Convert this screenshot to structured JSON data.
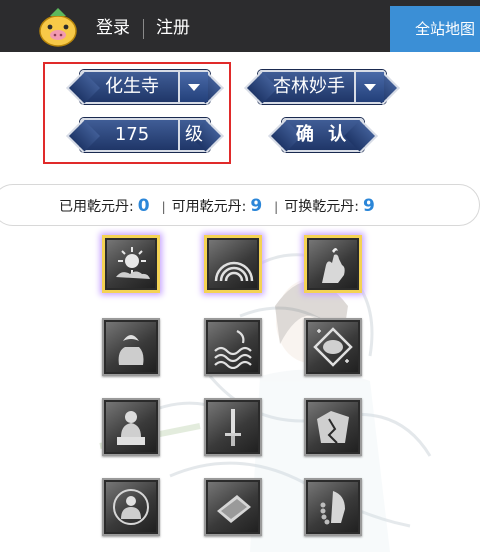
{
  "header": {
    "login_label": "登录",
    "register_label": "注册",
    "sitemap_label": "全站地图"
  },
  "selector": {
    "sect_value": "化生寺",
    "skill_value": "杏林妙手",
    "level_value": "175",
    "level_unit": "级",
    "confirm_label": "确 认"
  },
  "counts": {
    "used_label": "已用乾元丹:",
    "used_value": "0",
    "available_label": "可用乾元丹:",
    "available_value": "9",
    "exchangeable_label": "可换乾元丹:",
    "exchangeable_value": "9"
  },
  "colors": {
    "topbar": "#2c2c2e",
    "sitemap_button": "#3b8fd6",
    "highlight": "#e02a2a",
    "pill_fill": "#2a4680",
    "count_number": "#2b86d8",
    "active_skill_border": "#f4d354"
  },
  "skills": [
    {
      "icon": "sun-cloud-icon",
      "active": true
    },
    {
      "icon": "rainbow-icon",
      "active": true
    },
    {
      "icon": "hand-flame-icon",
      "active": true
    },
    {
      "icon": "lotus-hand-icon",
      "active": false
    },
    {
      "icon": "water-wave-icon",
      "active": false
    },
    {
      "icon": "mirror-diamond-icon",
      "active": false
    },
    {
      "icon": "buddha-statue-icon",
      "active": false
    },
    {
      "icon": "sword-icon",
      "active": false
    },
    {
      "icon": "broken-rock-icon",
      "active": false
    },
    {
      "icon": "meditating-buddha-icon",
      "active": false
    },
    {
      "icon": "tablet-icon",
      "active": false
    },
    {
      "icon": "prayer-beads-icon",
      "active": false
    }
  ]
}
